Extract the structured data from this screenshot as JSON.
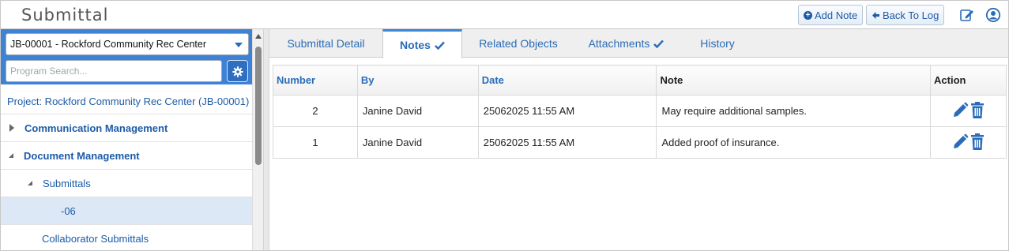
{
  "app": {
    "title": "Submittal"
  },
  "header": {
    "add_note_label": "Add Note",
    "back_to_log_label": "Back To Log",
    "add_icon": "plus-circle-icon",
    "back_icon": "arrow-left-icon",
    "edit_icon": "edit-icon",
    "user_icon": "user-circle-icon"
  },
  "sidebar": {
    "project_select_value": "JB-00001 - Rockford Community Rec Center",
    "search_placeholder": "Program Search...",
    "project_link": "Project: Rockford Community Rec Center (JB-00001)",
    "items": [
      {
        "label": "Communication Management"
      },
      {
        "label": "Document Management"
      },
      {
        "label": "Submittals"
      },
      {
        "label": "-06"
      },
      {
        "label": "Collaborator Submittals"
      }
    ]
  },
  "tabs": [
    {
      "label": "Submittal Detail"
    },
    {
      "label": "Notes"
    },
    {
      "label": "Related Objects"
    },
    {
      "label": "Attachments"
    },
    {
      "label": "History"
    }
  ],
  "table": {
    "columns": [
      "Number",
      "By",
      "Date",
      "Note",
      "Action"
    ],
    "rows": [
      {
        "number": "2",
        "by": "Janine David",
        "date": "25062025 11:55 AM",
        "note": "May require additional samples."
      },
      {
        "number": "1",
        "by": "Janine David",
        "date": "25062025 11:55 AM",
        "note": "Added proof of insurance."
      }
    ]
  },
  "colors": {
    "accent": "#3e82d6",
    "link": "#1c5ba8",
    "selected_row": "#dce8f6"
  }
}
